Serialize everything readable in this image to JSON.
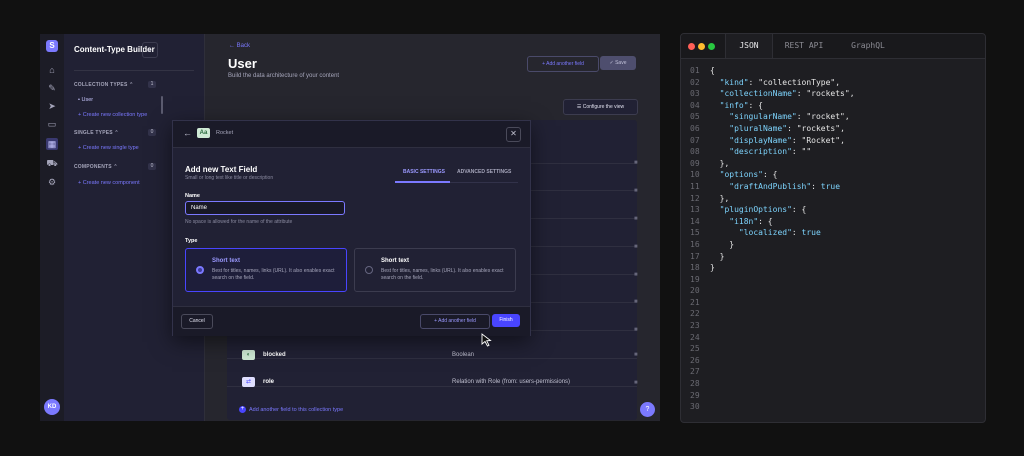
{
  "sidebar": {
    "title": "Content-Type Builder",
    "collection_types": {
      "label": "COLLECTION TYPES",
      "count": "1",
      "items": [
        "User"
      ],
      "create": "Create new collection type"
    },
    "single_types": {
      "label": "SINGLE TYPES",
      "count": "0",
      "create": "Create new single type"
    },
    "components": {
      "label": "COMPONENTS",
      "count": "0",
      "create": "Create new component"
    },
    "avatar": "KD"
  },
  "header": {
    "back": "Back",
    "title": "User",
    "subtitle": "Build the data architecture of your content",
    "add_field": "Add another field",
    "save": "Save",
    "configure": "Configure the view"
  },
  "table": {
    "rows": [
      {
        "name": "blocked",
        "type": "Boolean",
        "icon": "toggle-icon"
      },
      {
        "name": "role",
        "type": "Relation with Role (from: users-permissions)",
        "icon": "relation-icon"
      }
    ],
    "add_link": "Add another field to this collection type"
  },
  "modal": {
    "breadcrumb": "Rocket",
    "type_icon_text": "Aa",
    "title": "Add new Text Field",
    "subtitle": "Small or long text like title or description",
    "tabs": [
      "BASIC SETTINGS",
      "ADVANCED SETTINGS"
    ],
    "name_label": "Name",
    "name_value": "Name",
    "name_hint": "No space is allowed for the name of the attribute",
    "type_label": "Type",
    "options": [
      {
        "title": "Short text",
        "desc": "Best for titles, names, links (URL). It also enables exact search on the field.",
        "selected": true
      },
      {
        "title": "Short text",
        "desc": "Best for titles, names, links (URL). It also enables exact search on the field.",
        "selected": false
      }
    ],
    "cancel": "Cancel",
    "add_another": "Add another field",
    "finish": "Finish"
  },
  "code_panel": {
    "tabs": [
      "JSON",
      "REST API",
      "GraphQL"
    ],
    "active_tab": "JSON",
    "line_numbers": [
      "01",
      "02",
      "03",
      "04",
      "05",
      "06",
      "07",
      "08",
      "09",
      "10",
      "11",
      "12",
      "13",
      "14",
      "15",
      "16",
      "17",
      "18",
      "19",
      "20",
      "21",
      "22",
      "23",
      "24",
      "25",
      "26",
      "27",
      "28",
      "29",
      "30"
    ],
    "code": [
      "{",
      "  \"kind\": \"collectionType\",",
      "  \"collectionName\": \"rockets\",",
      "  \"info\": {",
      "    \"singularName\": \"rocket\",",
      "    \"pluralName\": \"rockets\",",
      "    \"displayName\": \"Rocket\",",
      "    \"description\": \"\"",
      "  },",
      "  \"options\": {",
      "    \"draftAndPublish\": true",
      "  },",
      "  \"pluginOptions\": {",
      "    \"i18n\": {",
      "      \"localized\": true",
      "    }",
      "  }",
      "}"
    ]
  },
  "colors": {
    "accent": "#4945ff",
    "accent_light": "#7b79ff",
    "key": "#7dd3fc"
  }
}
